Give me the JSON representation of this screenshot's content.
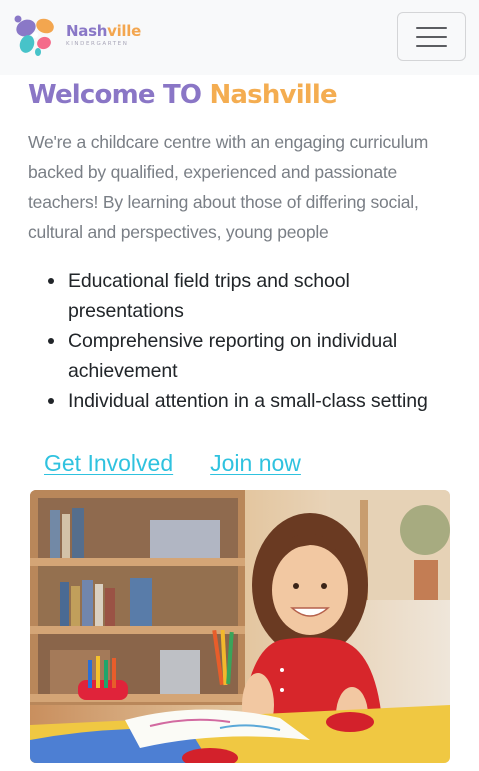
{
  "navbar": {
    "brand": {
      "name_part1": "Nash",
      "name_part2": "ville",
      "subtitle": "KINDERGARTEN"
    },
    "menu_icon": "hamburger-icon"
  },
  "hero": {
    "heading_part1": "Welcome TO ",
    "heading_part2": "Nashville",
    "intro": "We're a childcare centre with an engaging curriculum backed by qualified, experienced and passionate teachers! By learning about those of differing social, cultural and perspectives, young people",
    "features": [
      "Educational field trips and school presentations",
      "Comprehensive reporting on individual achievement",
      "Individual attention in a small-class setting"
    ],
    "links": {
      "get_involved": "Get Involved",
      "join_now": "Join now"
    }
  },
  "colors": {
    "purple": "#8a76c6",
    "orange": "#f4ad51",
    "link": "#2fc2df",
    "text_muted": "#7a7f86",
    "text_dark": "#212529"
  }
}
